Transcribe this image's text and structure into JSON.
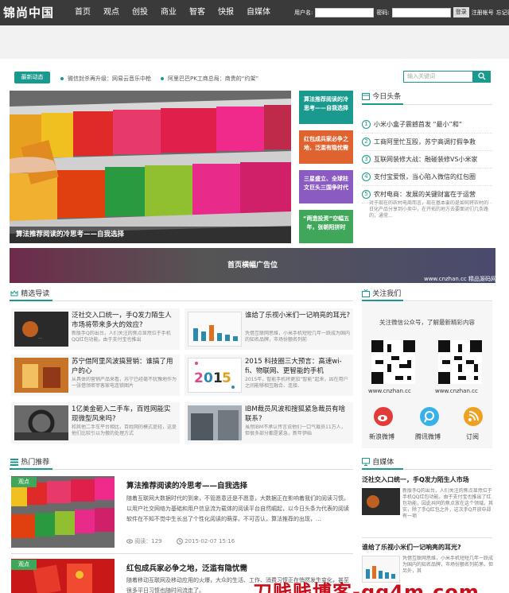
{
  "site": {
    "logo": "锦尚中国"
  },
  "nav": [
    "首页",
    "观点",
    "创投",
    "商业",
    "智客",
    "快报",
    "自媒体"
  ],
  "login": {
    "user_label": "用户名:",
    "pass_label": "密码:",
    "login_btn": "登录",
    "register": "注册帐号",
    "forgot": "忘记密码?"
  },
  "ticker": {
    "tag": "最新动态",
    "items": [
      "微信封杀再升级：网易云音乐中枪",
      "阿里巴巴PK工商总局：商贵的“约架”"
    ]
  },
  "search": {
    "placeholder": "输入关键词",
    "button_icon": "search-icon"
  },
  "hero": {
    "caption": "算法推荐阅读的冷思考——自我选择"
  },
  "side_cards": [
    {
      "title": "算法推荐阅读的冷思考——自我选择",
      "color": "#1a9a8e"
    },
    {
      "title": "红包成兵家必争之地，泛滥有隐忧需",
      "color": "#e0622e"
    },
    {
      "title": "三星盛立、全球柱文巨头三国争时代",
      "color": "#8a5bc0"
    },
    {
      "title": "“两造投资”空幅五年，张朝阳拼时",
      "color": "#3fa65a"
    }
  ],
  "toutiao": {
    "title": "今日头条",
    "items": [
      "小米小盒子震撼首发 “最小”和“",
      "工商阿里忙互殴，苏宁高调打假争救",
      "互联网装修大战：融碰装修VS小米家",
      "支付宝爱恨，当心陷入微信的红包圈",
      "农村电商：发展的关键财富在于运营"
    ],
    "desc": "对于现在的农村电商而言，现在基本要的是如何将农村的日化产品分享到小卖中，在开拓的地方去要面对们几条路的，通常..."
  },
  "ad": {
    "title": "首页横幅广告位",
    "foot": "www.cnzhan.cc 精品源码网"
  },
  "jingxuan": {
    "title": "精选导读",
    "items": [
      {
        "title": "泛社交入口统一，手Q发力陌生人市场将带来多大的效应?",
        "desc": "新版手Q的出台，人们关注的焦点显然位于手机QQ红包功能。由于支付宝也推出"
      },
      {
        "title": "谁给了乐视小米们一记响亮的耳光?",
        "desc": "凭借互联网思维，小米手机短短几年一跃成为国内的知名品牌，市场份额名列前"
      },
      {
        "title": "苏宁借阿里风波搞营销：谁搞了用户的心",
        "desc": "从具体的营销产品来看，苏宁已经毫不犹豫地作为一张借领密宰客家电连锁图片"
      },
      {
        "title": "2015 科技圈三大预言：高速wi-fi、物联网、更智能的手机",
        "desc": "2015年，智能手机将更加“智能”起来，因在用户之间能够相互融合、连接、"
      },
      {
        "title": "1亿美金砸入二手车，百姓网能实现微型风来吗?",
        "desc": "和其他二手车平台相比，百姓网的模式是轻，这是他们比较引以为傲的处理方式"
      },
      {
        "title": "IBM裁员风波和搜狐紧急裁员有啥联系?",
        "desc": "虽然IBM不承认传言说他们一口气裁员11万人，但很多部分都是紧急，新年伊始"
      }
    ]
  },
  "follow": {
    "title": "关注我们",
    "desc": "关注微信公众号，了解最新精彩内容",
    "qr1": "www.cnzhan.cc",
    "qr2": "www.cnzhan.cc",
    "links": [
      "新浪微博",
      "腾讯微博",
      "订阅"
    ]
  },
  "hot": {
    "title": "热门推荐",
    "items": [
      {
        "badge": "观点",
        "title": "算法推荐阅读的冷思考——自我选择",
        "desc": "随着互联网大数据时代的到来，不管愿意还是不愿意，大数据正在影响着我们的阅读习惯。以用户社交网络为基础和用户信息流为载体的阅读平台自然崛起，以今日头条为代表的阅读软件在不知不觉中生长出了个性化阅读的萌芽。不可否认，算法推荐的出现，...",
        "views": "阅读：129",
        "time": "2015-02-07 15:16"
      },
      {
        "badge": "观点",
        "title": "红包成兵家必争之地，泛滥有隐忧需",
        "desc": "随着移动互联网及移动应用的火爆，大众的生活、工作、消费习惯正在悄然发生变化，甚至很多平日习惯也随时间流走了。"
      }
    ]
  },
  "zimeiti": {
    "title": "自媒体",
    "items": [
      {
        "title": "泛社交入口统一，手Q发力陌生人市场",
        "desc": "新版手Q的出台，人们关注的焦点显然位于手机QQ红包功能。由于支付宝也推出了红包功能，因此共同的焦点放在这个领域。其实，除了手Q红包之外，这次手Q开放中却有一项"
      },
      {
        "title": "谁给了乐视小米们一记响亮的耳光?",
        "desc": "凭借互联网思维，小米手机短短几年一跃成为国内的知名品牌，市场份额名列前茅。但另外，其"
      }
    ]
  },
  "watermark": "刀贱贱博客-qq4m.com"
}
